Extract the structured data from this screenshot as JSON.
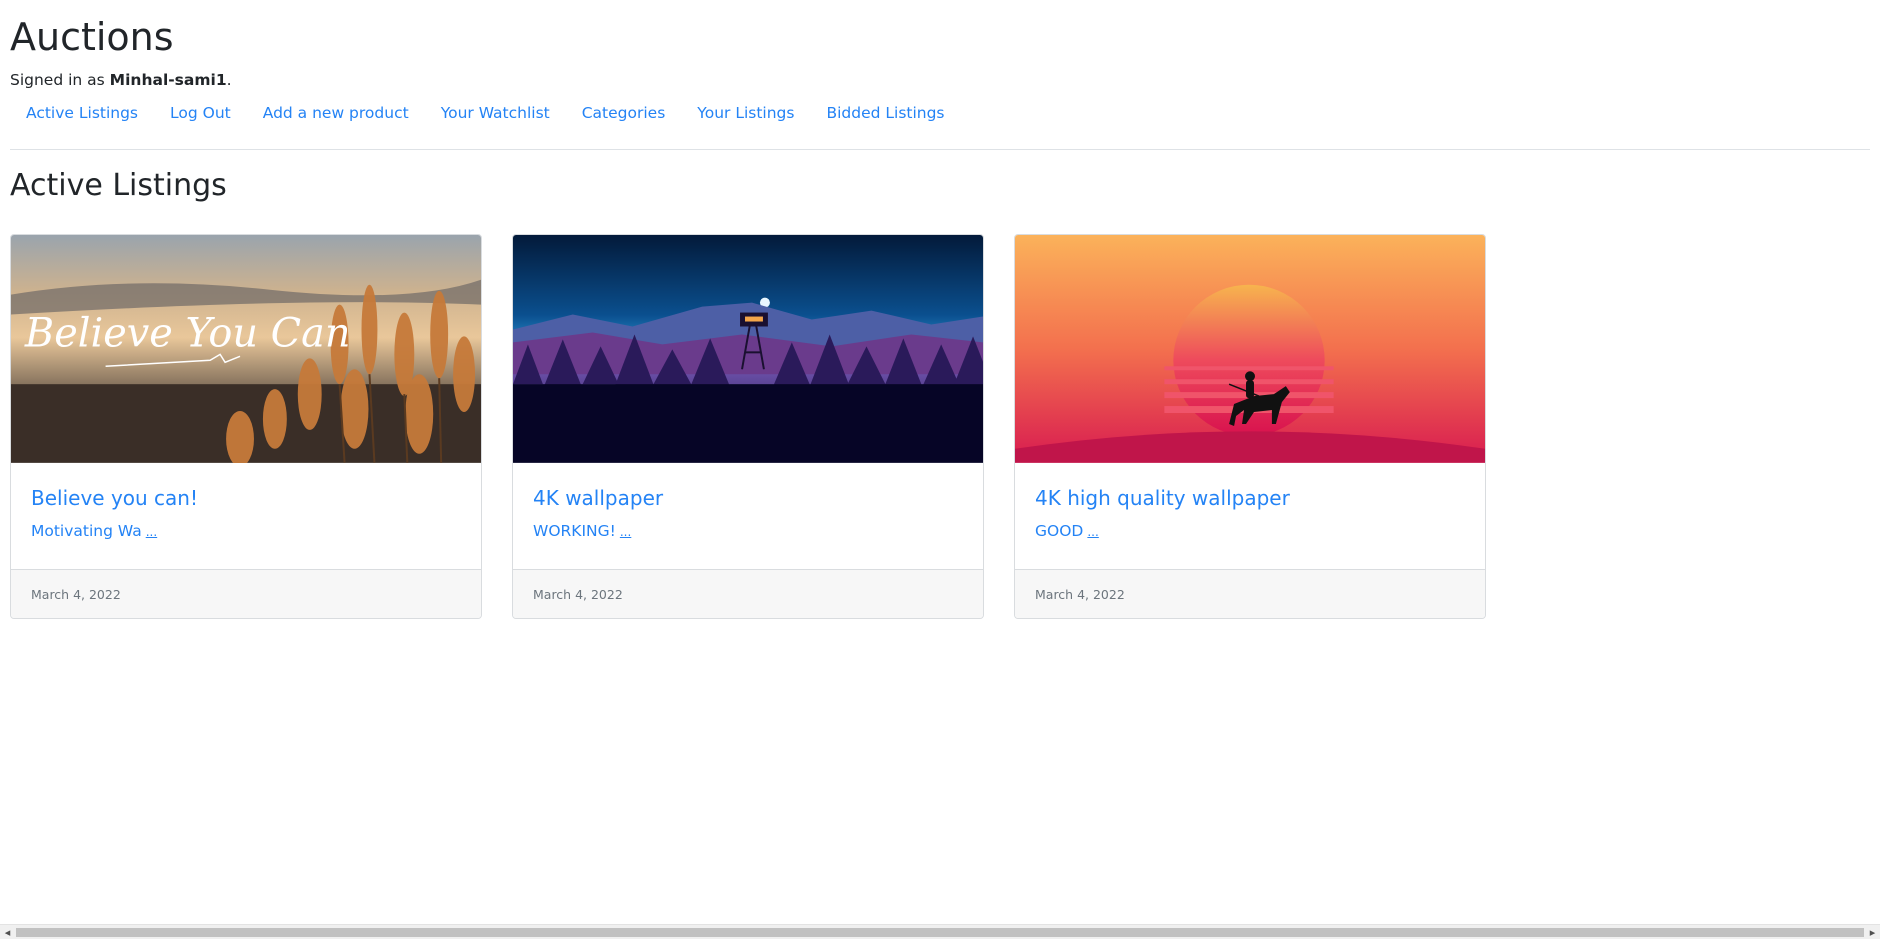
{
  "header": {
    "title": "Auctions",
    "signed_in_prefix": "Signed in as ",
    "username": "Minhal-sami1",
    "signed_in_suffix": "."
  },
  "nav": {
    "items": [
      {
        "label": "Active Listings"
      },
      {
        "label": "Log Out"
      },
      {
        "label": "Add a new product"
      },
      {
        "label": "Your Watchlist"
      },
      {
        "label": "Categories"
      },
      {
        "label": "Your Listings"
      },
      {
        "label": "Bidded Listings"
      }
    ]
  },
  "main": {
    "heading": "Active Listings",
    "listings": [
      {
        "title": "Believe you can!",
        "description": "Motivating Wa",
        "more": "...",
        "date": "March 4, 2022",
        "image_text": "Believe You Can"
      },
      {
        "title": "4K wallpaper",
        "description": "WORKING!",
        "more": "...",
        "date": "March 4, 2022"
      },
      {
        "title": "4K high quality wallpaper",
        "description": "GOOD",
        "more": "...",
        "date": "March 4, 2022"
      }
    ]
  },
  "colors": {
    "link": "#2483f5",
    "text": "#212529",
    "muted": "#6c757d",
    "card_border": "#d9dcdf",
    "footer_bg": "#f7f7f7"
  },
  "scrollbar": {
    "left_arrow": "◂",
    "right_arrow": "▸"
  }
}
